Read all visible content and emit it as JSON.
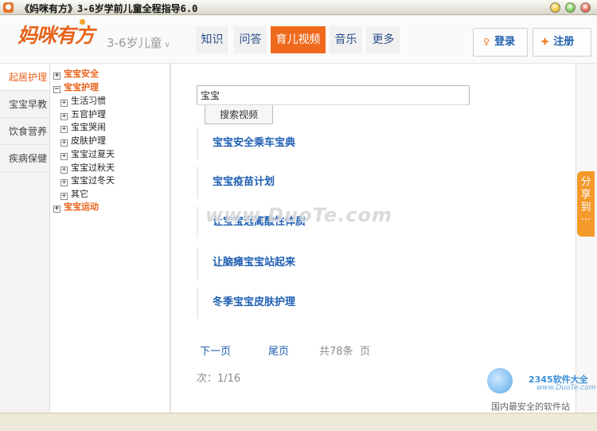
{
  "window": {
    "title": "《妈咪有方》3-6岁学前儿童全程指导6.0",
    "minimize": "–",
    "maximize": "+",
    "close": "×"
  },
  "header": {
    "logo": "妈咪有方",
    "age_selector": "3-6岁儿童",
    "nav": [
      {
        "label": "知识"
      },
      {
        "label": "问答"
      },
      {
        "label": "育儿视频",
        "active": true
      },
      {
        "label": "音乐"
      },
      {
        "label": "更多"
      }
    ],
    "login_label": "登录",
    "register_label": "注册"
  },
  "sidemenu": {
    "items": [
      {
        "label": "起居护理",
        "active": true
      },
      {
        "label": "宝宝早教"
      },
      {
        "label": "饮食营养"
      },
      {
        "label": "疾病保健"
      }
    ]
  },
  "tree": {
    "nodes": [
      {
        "label": "宝宝安全",
        "level": 0,
        "toggle": "+"
      },
      {
        "label": "宝宝护理",
        "level": 0,
        "toggle": "−"
      },
      {
        "label": "生活习惯",
        "level": 1,
        "toggle": "+"
      },
      {
        "label": "五官护理",
        "level": 1,
        "toggle": "+"
      },
      {
        "label": "宝宝哭闹",
        "level": 1,
        "toggle": "+"
      },
      {
        "label": "皮肤护理",
        "level": 1,
        "toggle": "+"
      },
      {
        "label": "宝宝过夏天",
        "level": 1,
        "toggle": "+"
      },
      {
        "label": "宝宝过秋天",
        "level": 1,
        "toggle": "+"
      },
      {
        "label": "宝宝过冬天",
        "level": 1,
        "toggle": "+"
      },
      {
        "label": "其它",
        "level": 1,
        "toggle": "+"
      },
      {
        "label": "宝宝运动",
        "level": 0,
        "toggle": "+"
      }
    ]
  },
  "search": {
    "value": "宝宝",
    "button": "搜索视频"
  },
  "videos": [
    {
      "title": "宝宝安全乘车宝典"
    },
    {
      "title": "宝宝疫苗计划"
    },
    {
      "title": "让宝宝远离酸性体质"
    },
    {
      "title": "让脑瘫宝宝站起来"
    },
    {
      "title": "冬季宝宝皮肤护理"
    }
  ],
  "pager": {
    "next": "下一页",
    "last": "尾页",
    "total": "共78条",
    "page_suffix": "页",
    "current": "次：1/16"
  },
  "share": {
    "label": "分享到",
    "dots": "···"
  },
  "watermarks": {
    "site": "www.DuoTe.com",
    "brand": "2345软件大全",
    "url": "www.DuoTe.com",
    "tagline": "国内最安全的软件站"
  }
}
